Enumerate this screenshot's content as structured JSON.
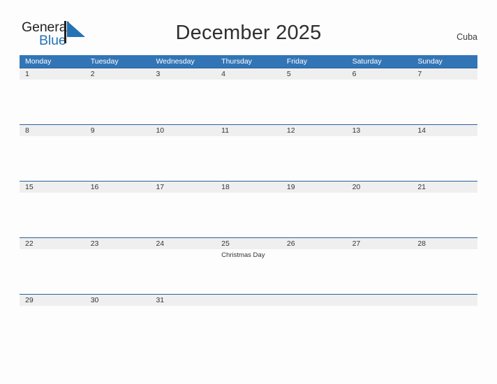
{
  "brand": {
    "name_part1": "General",
    "name_part2": "Blue",
    "color_dark": "#231f20",
    "color_blue": "#2572b6"
  },
  "header": {
    "title": "December 2025",
    "country": "Cuba"
  },
  "calendar": {
    "accent_color": "#3275b6",
    "band_color": "#efefef",
    "day_names": [
      "Monday",
      "Tuesday",
      "Wednesday",
      "Thursday",
      "Friday",
      "Saturday",
      "Sunday"
    ],
    "weeks": [
      [
        {
          "day": "1",
          "event": ""
        },
        {
          "day": "2",
          "event": ""
        },
        {
          "day": "3",
          "event": ""
        },
        {
          "day": "4",
          "event": ""
        },
        {
          "day": "5",
          "event": ""
        },
        {
          "day": "6",
          "event": ""
        },
        {
          "day": "7",
          "event": ""
        }
      ],
      [
        {
          "day": "8",
          "event": ""
        },
        {
          "day": "9",
          "event": ""
        },
        {
          "day": "10",
          "event": ""
        },
        {
          "day": "11",
          "event": ""
        },
        {
          "day": "12",
          "event": ""
        },
        {
          "day": "13",
          "event": ""
        },
        {
          "day": "14",
          "event": ""
        }
      ],
      [
        {
          "day": "15",
          "event": ""
        },
        {
          "day": "16",
          "event": ""
        },
        {
          "day": "17",
          "event": ""
        },
        {
          "day": "18",
          "event": ""
        },
        {
          "day": "19",
          "event": ""
        },
        {
          "day": "20",
          "event": ""
        },
        {
          "day": "21",
          "event": ""
        }
      ],
      [
        {
          "day": "22",
          "event": ""
        },
        {
          "day": "23",
          "event": ""
        },
        {
          "day": "24",
          "event": ""
        },
        {
          "day": "25",
          "event": "Christmas Day"
        },
        {
          "day": "26",
          "event": ""
        },
        {
          "day": "27",
          "event": ""
        },
        {
          "day": "28",
          "event": ""
        }
      ],
      [
        {
          "day": "29",
          "event": ""
        },
        {
          "day": "30",
          "event": ""
        },
        {
          "day": "31",
          "event": ""
        },
        {
          "day": "",
          "event": ""
        },
        {
          "day": "",
          "event": ""
        },
        {
          "day": "",
          "event": ""
        },
        {
          "day": "",
          "event": ""
        }
      ]
    ]
  }
}
